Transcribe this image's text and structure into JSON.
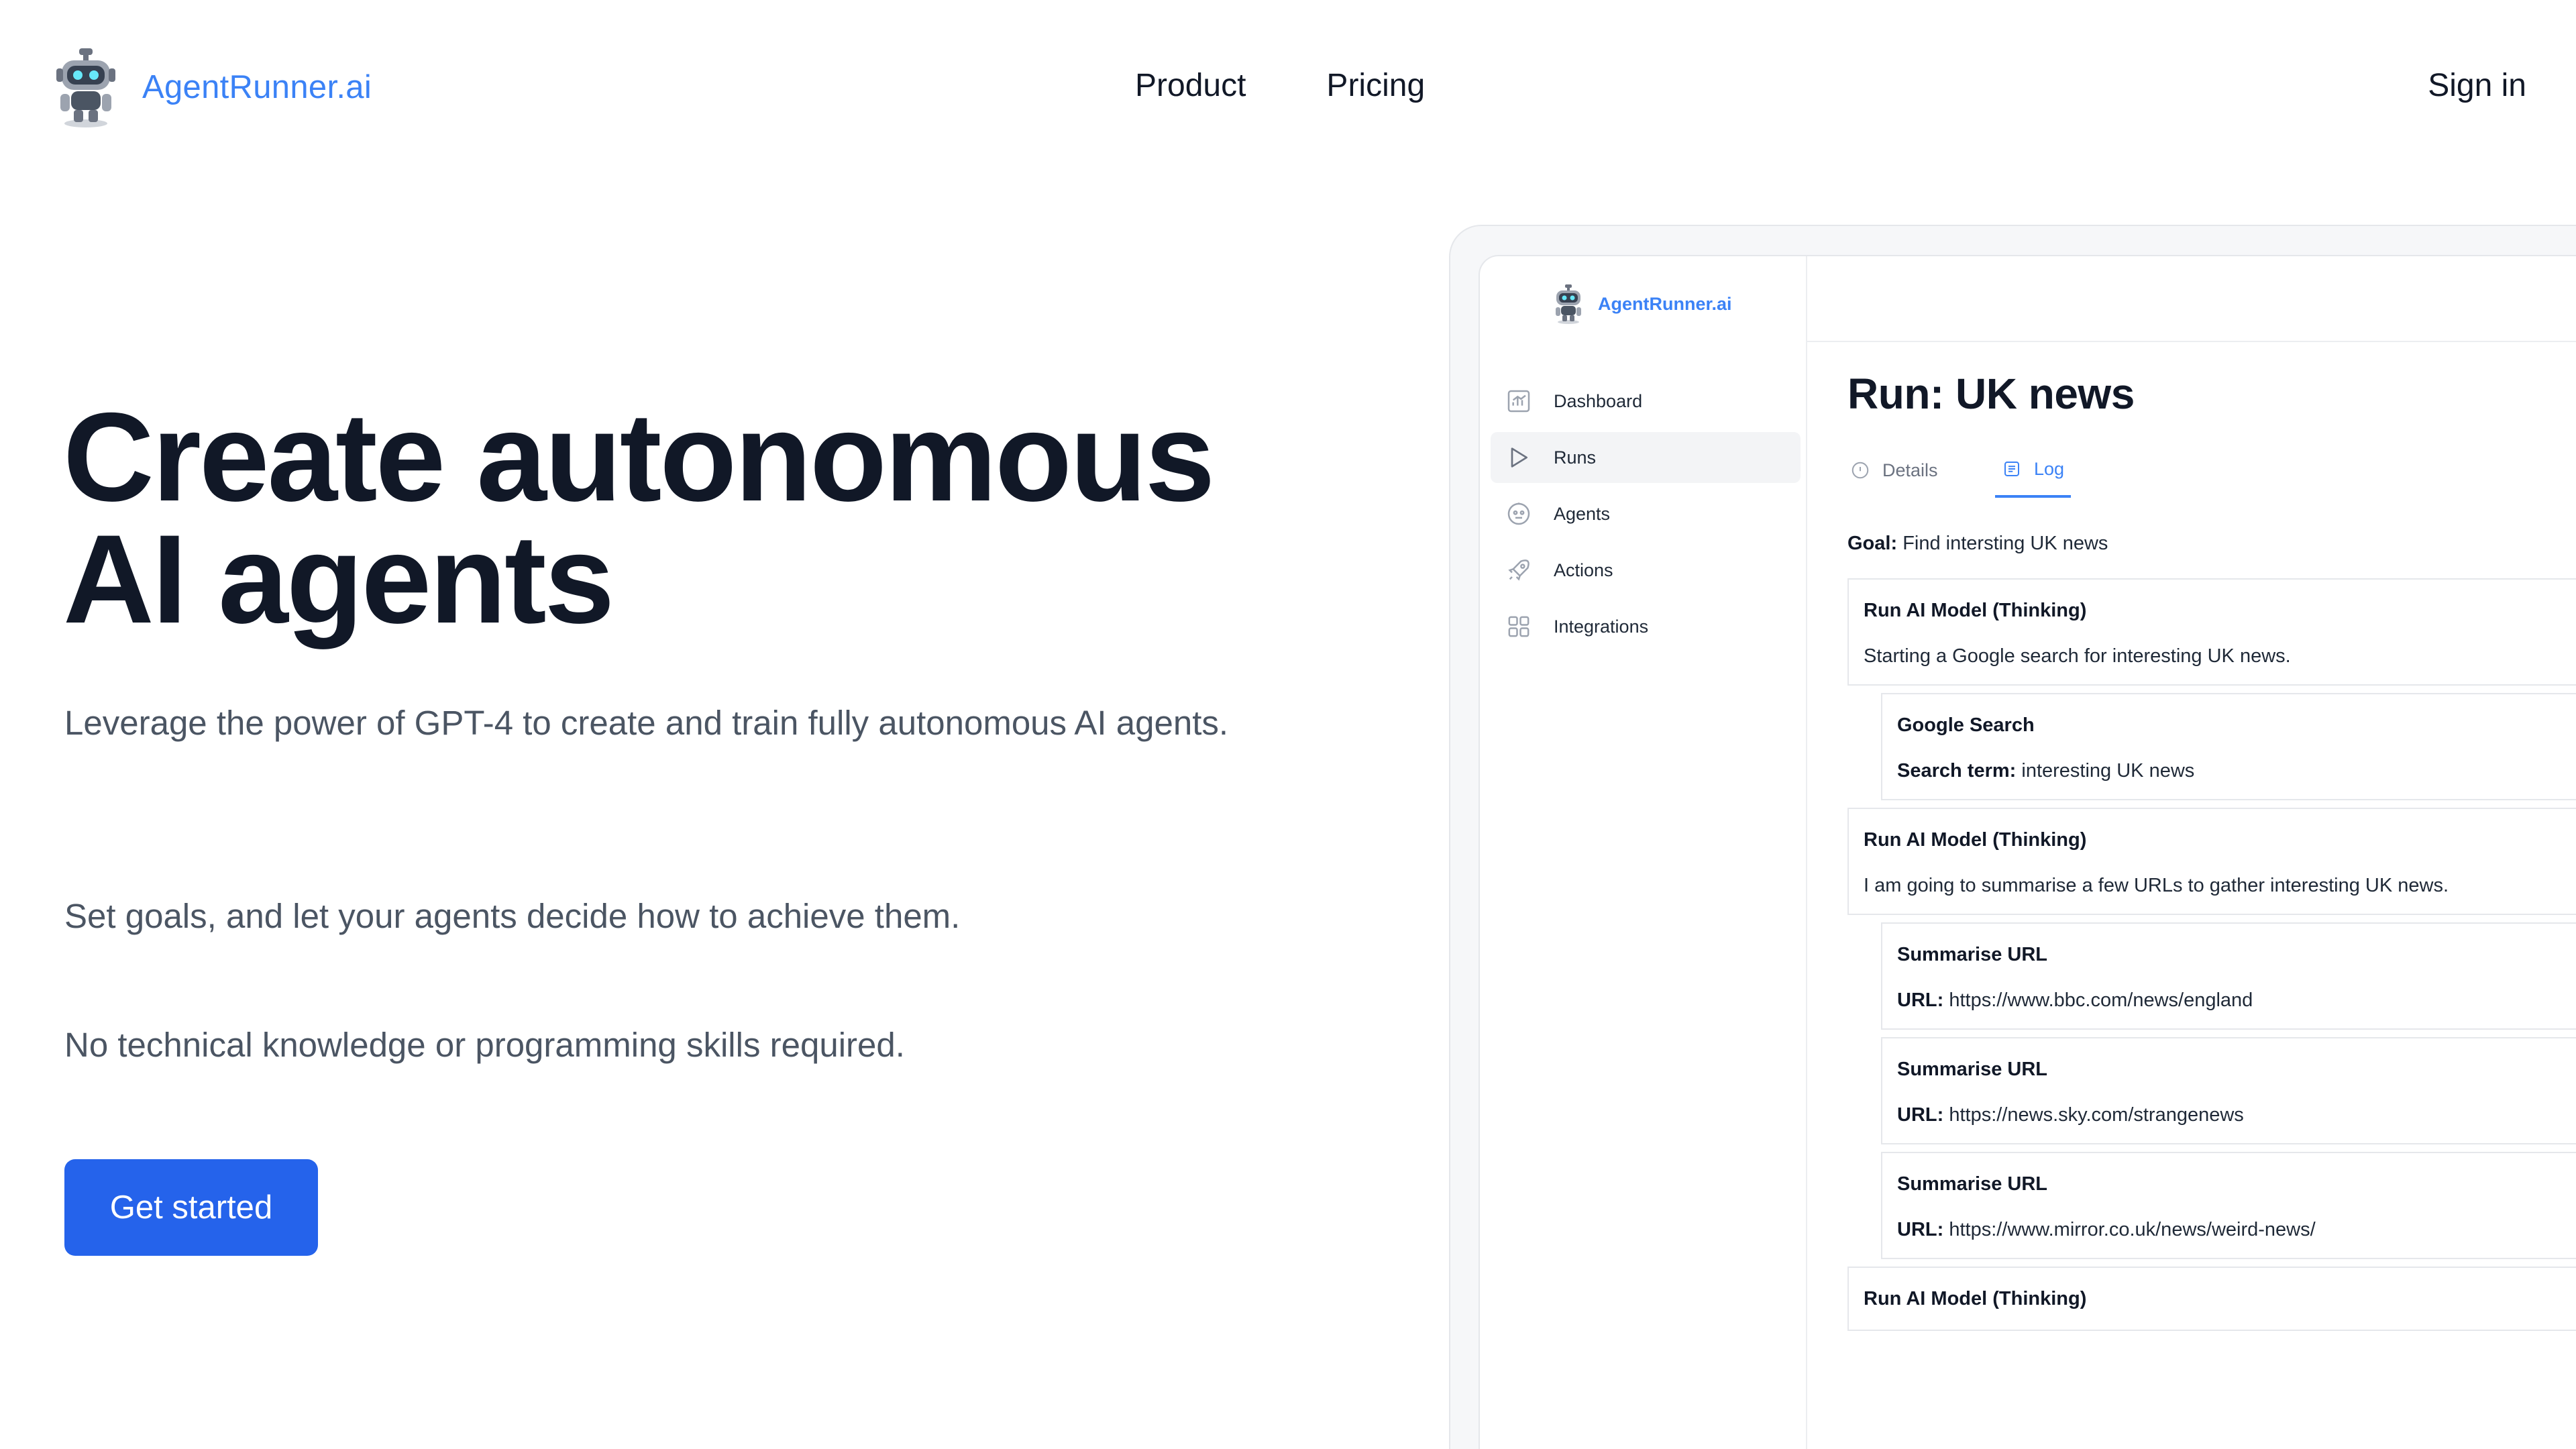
{
  "nav": {
    "brand": "AgentRunner.ai",
    "links": [
      "Product",
      "Pricing"
    ],
    "sign_in": "Sign in"
  },
  "hero": {
    "title_line1": "Create autonomous",
    "title_line2": "AI agents",
    "paragraph1": "Leverage the power of GPT-4 to create and train fully autonomous AI agents.",
    "paragraph2": "Set goals, and let your agents decide how to achieve them.",
    "paragraph3": "No technical knowledge or programming skills required.",
    "cta": "Get started"
  },
  "colors": {
    "brand_blue": "#3b82f6",
    "cta_blue": "#2563eb",
    "text_dark": "#111827",
    "text_muted": "#4b5563"
  },
  "app": {
    "brand": "AgentRunner.ai",
    "sidebar": [
      {
        "label": "Dashboard",
        "icon": "chart-icon"
      },
      {
        "label": "Runs",
        "icon": "play-icon",
        "active": true
      },
      {
        "label": "Agents",
        "icon": "robot-icon"
      },
      {
        "label": "Actions",
        "icon": "rocket-icon"
      },
      {
        "label": "Integrations",
        "icon": "grid-icon"
      }
    ],
    "run_title": "Run: UK news",
    "tabs": [
      {
        "label": "Details",
        "icon": "info-icon"
      },
      {
        "label": "Log",
        "icon": "log-icon",
        "active": true
      }
    ],
    "goal_label": "Goal:",
    "goal_value": "Find intersting UK news",
    "log": [
      {
        "title": "Run AI Model (Thinking)",
        "body": "Starting a Google search for interesting UK news."
      },
      {
        "title": "Google Search",
        "label": "Search term:",
        "value": "interesting UK news"
      },
      {
        "title": "Run AI Model (Thinking)",
        "body": "I am going to summarise a few URLs to gather interesting UK news."
      },
      {
        "title": "Summarise URL",
        "label": "URL:",
        "value": "https://www.bbc.com/news/england"
      },
      {
        "title": "Summarise URL",
        "label": "URL:",
        "value": "https://news.sky.com/strangenews"
      },
      {
        "title": "Summarise URL",
        "label": "URL:",
        "value": "https://www.mirror.co.uk/news/weird-news/"
      },
      {
        "title": "Run AI Model (Thinking)"
      }
    ]
  }
}
